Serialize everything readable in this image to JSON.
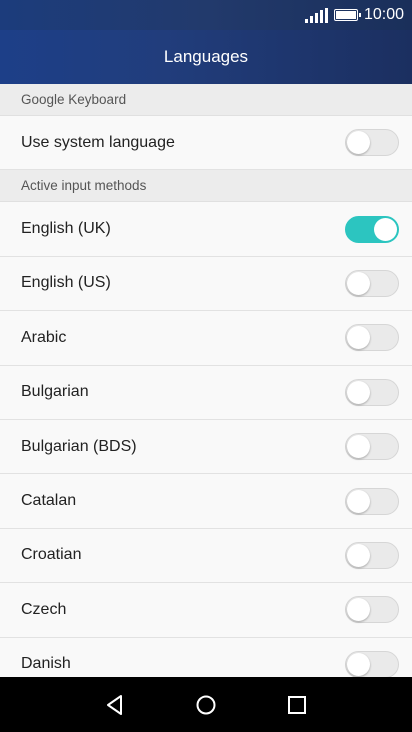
{
  "status_bar": {
    "time": "10:00"
  },
  "app_bar": {
    "title": "Languages"
  },
  "sections": [
    {
      "header": "Google Keyboard",
      "items": [
        {
          "label": "Use system language",
          "enabled": false
        }
      ]
    },
    {
      "header": "Active input methods",
      "items": [
        {
          "label": "English (UK)",
          "enabled": true
        },
        {
          "label": "English (US)",
          "enabled": false
        },
        {
          "label": "Arabic",
          "enabled": false
        },
        {
          "label": "Bulgarian",
          "enabled": false
        },
        {
          "label": "Bulgarian (BDS)",
          "enabled": false
        },
        {
          "label": "Catalan",
          "enabled": false
        },
        {
          "label": "Croatian",
          "enabled": false
        },
        {
          "label": "Czech",
          "enabled": false
        },
        {
          "label": "Danish",
          "enabled": false
        }
      ]
    }
  ],
  "colors": {
    "accent": "#2cc5c0",
    "app_bar": "#1d3f88"
  },
  "nav_icons": [
    "back-icon",
    "home-icon",
    "recents-icon"
  ]
}
